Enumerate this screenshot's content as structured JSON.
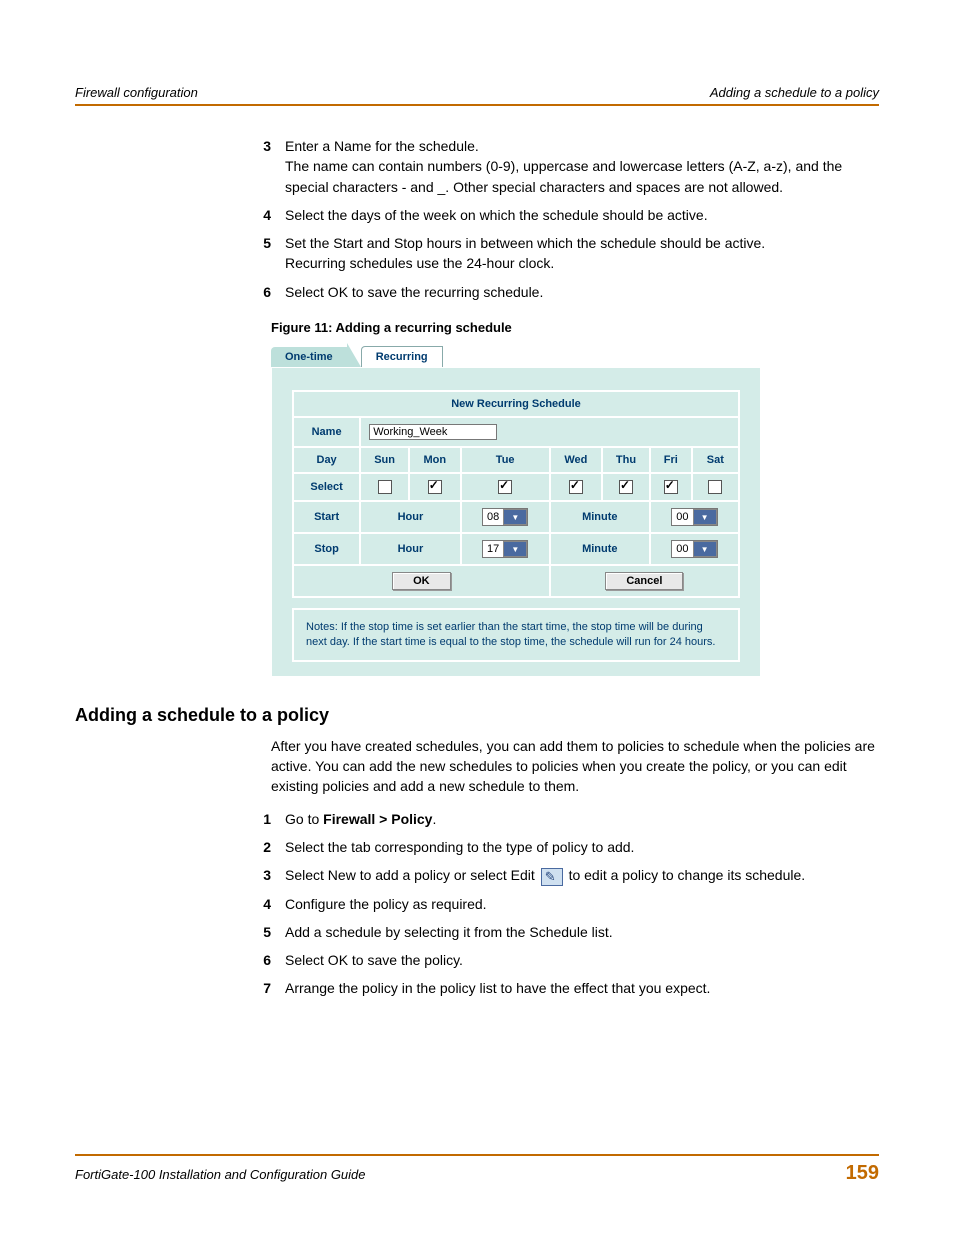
{
  "header": {
    "left": "Firewall configuration",
    "right": "Adding a schedule to a policy"
  },
  "steps_a": [
    {
      "n": "3",
      "body": "Enter a Name for the schedule.",
      "extra": "The name can contain numbers (0-9), uppercase and lowercase letters (A-Z, a-z), and the special characters - and _. Other special characters and spaces are not allowed."
    },
    {
      "n": "4",
      "body": "Select the days of the week on which the schedule should be active."
    },
    {
      "n": "5",
      "body": "Set the Start and Stop hours in between which the schedule should be active.",
      "extra": "Recurring schedules use the 24-hour clock."
    },
    {
      "n": "6",
      "body": "Select OK to save the recurring schedule."
    }
  ],
  "figure_caption": "Figure 11: Adding a recurring schedule",
  "tabs": {
    "one": "One-time",
    "recurring": "Recurring"
  },
  "schedule": {
    "title": "New Recurring Schedule",
    "name_label": "Name",
    "name_value": "Working_Week",
    "day_label": "Day",
    "days": [
      "Sun",
      "Mon",
      "Tue",
      "Wed",
      "Thu",
      "Fri",
      "Sat"
    ],
    "select_label": "Select",
    "checks": [
      false,
      true,
      true,
      true,
      true,
      true,
      false
    ],
    "start_label": "Start",
    "stop_label": "Stop",
    "hour_label": "Hour",
    "minute_label": "Minute",
    "start_hour": "08",
    "start_minute": "00",
    "stop_hour": "17",
    "stop_minute": "00",
    "ok": "OK",
    "cancel": "Cancel",
    "notes": "Notes: If the stop time is set earlier than the start time, the stop time will be during next day. If the start time is equal to the stop time, the schedule will run for 24 hours."
  },
  "section_heading": "Adding a schedule to a policy",
  "section_intro": "After you have created schedules, you can add them to policies to schedule when the policies are active. You can add the new schedules to policies when you create the policy, or you can edit existing policies and add a new schedule to them.",
  "steps_b": [
    {
      "n": "1",
      "pre": "Go to ",
      "bold": "Firewall > Policy",
      "post": "."
    },
    {
      "n": "2",
      "body": "Select the tab corresponding to the type of policy to add."
    },
    {
      "n": "3",
      "pre": "Select New to add a policy or select Edit ",
      "icon": true,
      "post": " to edit a policy to change its schedule."
    },
    {
      "n": "4",
      "body": "Configure the policy as required."
    },
    {
      "n": "5",
      "body": "Add a schedule by selecting it from the Schedule list."
    },
    {
      "n": "6",
      "body": "Select OK to save the policy."
    },
    {
      "n": "7",
      "body": "Arrange the policy in the policy list to have the effect that you expect."
    }
  ],
  "footer": {
    "left": "FortiGate-100 Installation and Configuration Guide",
    "page": "159"
  }
}
